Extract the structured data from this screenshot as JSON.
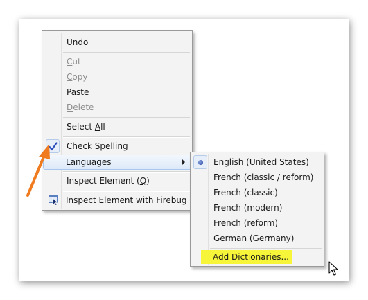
{
  "context_menu": {
    "items": [
      {
        "pre": "",
        "key": "U",
        "post": "ndo",
        "disabled": false
      },
      {
        "pre": "",
        "key": "C",
        "post": "ut",
        "disabled": true
      },
      {
        "pre": "",
        "key": "C",
        "post": "opy",
        "disabled": true
      },
      {
        "pre": "",
        "key": "P",
        "post": "aste",
        "disabled": false
      },
      {
        "pre": "",
        "key": "D",
        "post": "elete",
        "disabled": true
      },
      {
        "pre": "Select ",
        "key": "A",
        "post": "ll",
        "disabled": false
      },
      {
        "pre": "Check Spellin",
        "key": "g",
        "post": "",
        "disabled": false,
        "checked": true
      },
      {
        "pre": "",
        "key": "L",
        "post": "anguages",
        "disabled": false,
        "submenu": true
      },
      {
        "pre": "Inspect Element (",
        "key": "Q",
        "post": ")",
        "disabled": false
      },
      {
        "pre": "Inspect Element with Firebug",
        "key": "",
        "post": "",
        "disabled": false,
        "icon": "firebug-icon"
      }
    ]
  },
  "languages_menu": {
    "items": [
      {
        "label": "English (United States)",
        "selected": true
      },
      {
        "label": "French (classic / reform)"
      },
      {
        "label": "French (classic)"
      },
      {
        "label": "French (modern)"
      },
      {
        "label": "French (reform)"
      },
      {
        "label": "German (Germany)"
      }
    ],
    "add_dictionaries": {
      "pre": "",
      "key": "A",
      "post": "dd Dictionaries..."
    }
  },
  "colors": {
    "highlight": "#f7f53a",
    "annotation_arrow": "#f07a1e",
    "checkmark": "#2a4dbb"
  }
}
